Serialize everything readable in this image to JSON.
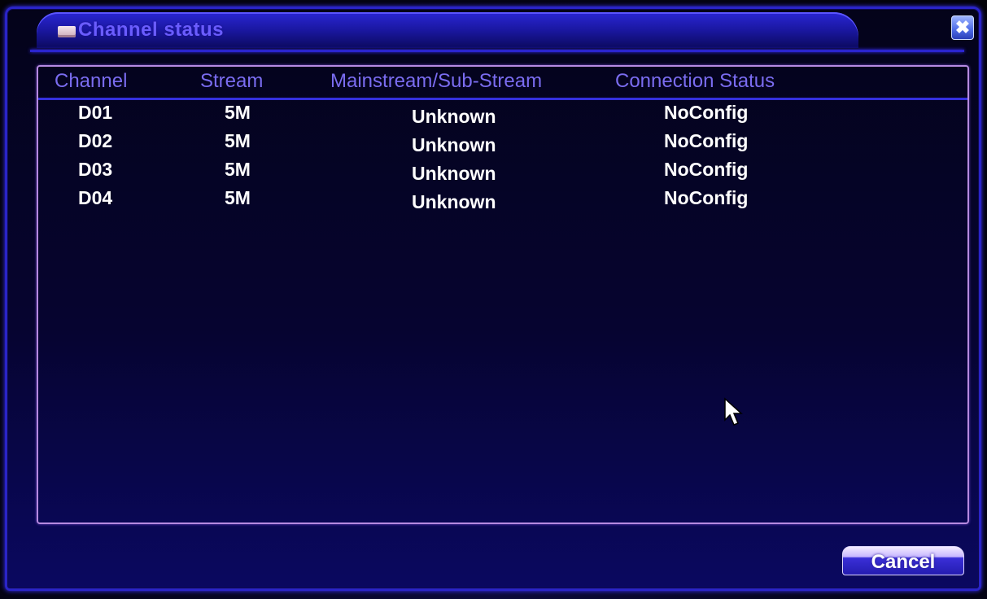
{
  "window": {
    "title": "Channel status",
    "close_glyph": "✖"
  },
  "table": {
    "columns": [
      "Channel",
      "Stream",
      "Mainstream/Sub-Stream",
      "Connection Status"
    ],
    "rows": [
      {
        "channel": "D01",
        "stream": "5M",
        "substream": "Unknown",
        "status": "NoConfig"
      },
      {
        "channel": "D02",
        "stream": "5M",
        "substream": "Unknown",
        "status": "NoConfig"
      },
      {
        "channel": "D03",
        "stream": "5M",
        "substream": "Unknown",
        "status": "NoConfig"
      },
      {
        "channel": "D04",
        "stream": "5M",
        "substream": "Unknown",
        "status": "NoConfig"
      }
    ]
  },
  "footer": {
    "cancel_label": "Cancel"
  },
  "colors": {
    "window_border": "#2a24c8",
    "header_text": "#7a6cf0",
    "cell_text": "#ffffff",
    "list_border": "#b68ae0"
  },
  "icons": {
    "title": "window-icon",
    "close": "close-icon",
    "cursor": "mouse-pointer-icon"
  }
}
